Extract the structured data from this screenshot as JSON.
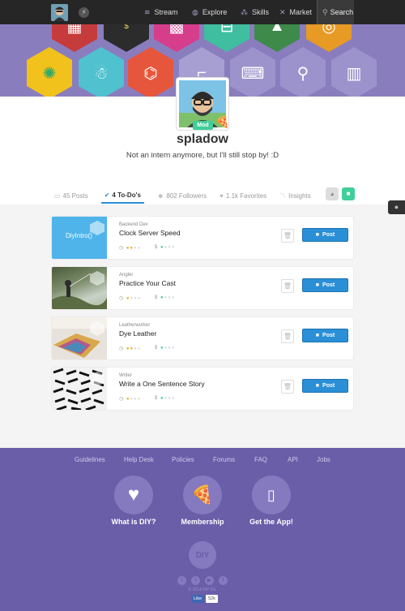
{
  "nav": {
    "stream": "Stream",
    "explore": "Explore",
    "skills": "Skills",
    "market": "Market",
    "search": "Search"
  },
  "profile": {
    "badge": "Mod",
    "username": "spladow",
    "bio": "Not an intern anymore, but I'll still stop by!  :D"
  },
  "tabs": [
    {
      "label": "45 Posts",
      "icon": "posts-icon"
    },
    {
      "label": "4 To-Do's",
      "icon": "check-icon"
    },
    {
      "label": "802 Followers",
      "icon": "followers-icon"
    },
    {
      "label": "1.1k Favorites",
      "icon": "heart-icon"
    },
    {
      "label": "Insights",
      "icon": "chart-icon"
    }
  ],
  "todos": [
    {
      "category": "Backend Dev",
      "title": "Clock Server Speed",
      "thumb_text": "DiyIntro()",
      "difficulty": 2,
      "cost": 1,
      "post": "Post"
    },
    {
      "category": "Angler",
      "title": "Practice Your Cast",
      "thumb_text": "",
      "difficulty": 1,
      "cost": 1,
      "post": "Post"
    },
    {
      "category": "Leatherworker",
      "title": "Dye Leather",
      "thumb_text": "",
      "difficulty": 2,
      "cost": 1,
      "post": "Post"
    },
    {
      "category": "Writer",
      "title": "Write a One Sentence Story",
      "thumb_text": "",
      "difficulty": 1,
      "cost": 1,
      "post": "Post"
    }
  ],
  "footer": {
    "links": [
      "Guidelines",
      "Help Desk",
      "Policies",
      "Forums",
      "FAQ",
      "API",
      "Jobs"
    ],
    "promos": [
      "What is DIY?",
      "Membership",
      "Get the App!"
    ],
    "logo": "DIY",
    "copyright": "© 2014 DIY Co.",
    "fb_like": "Like",
    "fb_count": "52k"
  },
  "colors": {
    "accent": "#2a8fd6",
    "footer": "#6a5ea9",
    "banner": "#8a7dbe",
    "mod": "#3fcf9a",
    "topbar": "#262626"
  }
}
